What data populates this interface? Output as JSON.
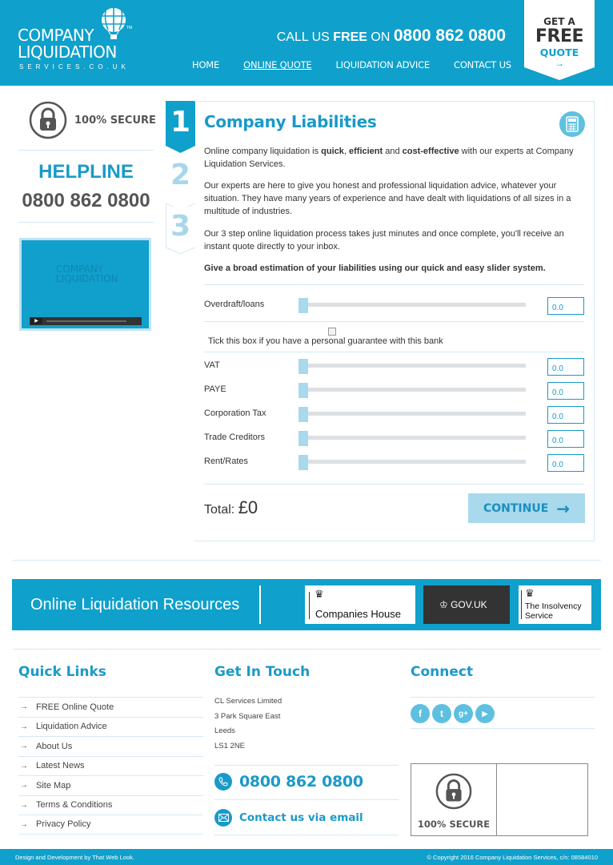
{
  "brand": {
    "line1": "COMPANY",
    "line2": "LIQUIDATION",
    "line3": "SERVICES.CO.UK",
    "tm": "TM",
    "primary_color": "#0fa0cb",
    "light_color": "#a9d9ec"
  },
  "header": {
    "call_prefix": "CALL US ",
    "call_free": "FREE",
    "call_on": " ON ",
    "phone": "0800 862 0800",
    "nav": [
      {
        "label": "HOME",
        "active": false
      },
      {
        "label": "ONLINE QUOTE",
        "active": true
      },
      {
        "label": "LIQUIDATION ADVICE",
        "active": false
      },
      {
        "label": "CONTACT US",
        "active": false
      }
    ],
    "free_quote": {
      "line1": "GET A",
      "line2": "FREE",
      "line3": "QUOTE",
      "arrow": "→"
    }
  },
  "sidebar": {
    "secure_label": "100% SECURE",
    "helpline_label": "HELPLINE",
    "helpline_number": "0800 862 0800",
    "video": {
      "logo_line1": "COMPANY",
      "logo_line2": "LIQUIDATION",
      "play_icon": "▶"
    }
  },
  "steps": [
    {
      "number": "1",
      "active": true
    },
    {
      "number": "2",
      "active": false
    },
    {
      "number": "3",
      "active": false
    }
  ],
  "panel": {
    "title": "Company Liabilities",
    "intro": {
      "t1": "Online company liquidation is ",
      "b1": "quick",
      "t2": ", ",
      "b2": "efficient",
      "t3": " and ",
      "b3": "cost-effective",
      "t4": " with our experts at Company Liquidation Services."
    },
    "para2": "Our experts are here to give you honest and professional liquidation advice, whatever your situation. They have many years of experience and have dealt with liquidations of all sizes in a multitude of industries.",
    "para3": "Our 3 step online liquidation process takes just minutes and once complete, you'll receive an instant quote directly to your inbox.",
    "instruction": "Give a broad estimation of your liabilities using our quick and easy slider system.",
    "liabilities": [
      {
        "label": "Overdraft/loans",
        "value": "0.0",
        "slider_fraction": 0
      },
      {
        "label": "VAT",
        "value": "0.0",
        "slider_fraction": 0
      },
      {
        "label": "PAYE",
        "value": "0.0",
        "slider_fraction": 0
      },
      {
        "label": "Corporation Tax",
        "value": "0.0",
        "slider_fraction": 0
      },
      {
        "label": "Trade Creditors",
        "value": "0.0",
        "slider_fraction": 0
      },
      {
        "label": "Rent/Rates",
        "value": "0.0",
        "slider_fraction": 0
      }
    ],
    "guarantee_label": "Tick this box if you have a personal guarantee with this bank",
    "guarantee_checked": false,
    "total_label": "Total: ",
    "total_value": "£0",
    "continue_label": "CONTINUE",
    "continue_arrow": "→"
  },
  "resources": {
    "title": "Online Liquidation Resources",
    "logos": [
      {
        "name": "Companies House"
      },
      {
        "name": "GOV.UK"
      },
      {
        "name_line1": "The Insolvency",
        "name_line2": "Service"
      }
    ]
  },
  "footer": {
    "quick_links_title": "Quick Links",
    "quick_links": [
      "FREE Online Quote",
      "Liquidation Advice",
      "About Us",
      "Latest News",
      "Site Map",
      "Terms & Conditions",
      "Privacy Policy"
    ],
    "get_in_touch_title": "Get In Touch",
    "address": [
      "CL Services Limited",
      "3 Park Square East",
      "Leeds",
      "LS1 2NE"
    ],
    "phone": "0800 862 0800",
    "email_label": "Contact us via email",
    "connect_title": "Connect",
    "social": [
      {
        "name": "facebook",
        "glyph": "f"
      },
      {
        "name": "twitter",
        "glyph": "t"
      },
      {
        "name": "google-plus",
        "glyph": "g+"
      },
      {
        "name": "youtube",
        "glyph": "▶"
      }
    ],
    "secure_label": "100% SECURE"
  },
  "bottom_bar": {
    "credit": "Design and Development by That Web Look.",
    "copyright": "© Copyright 2016 Company Liquidation Services, c/n: 08584010"
  }
}
